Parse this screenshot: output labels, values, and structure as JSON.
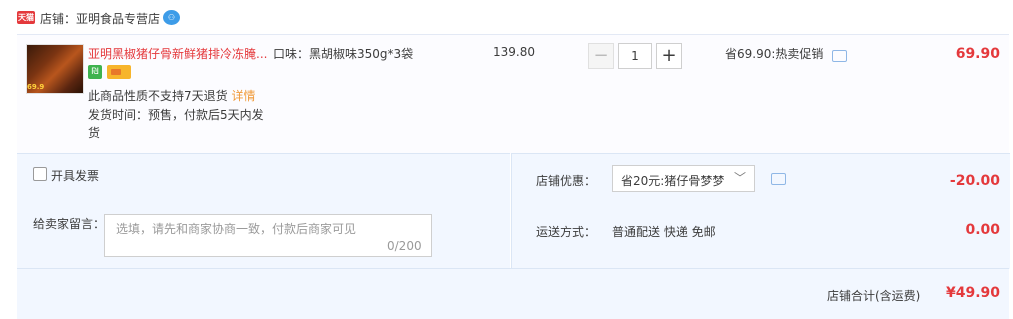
{
  "shop": {
    "badge": "天猫",
    "label": "店铺：亚明食品专营店",
    "chat_icon": "chat-icon"
  },
  "item": {
    "thumb_price": "69.9",
    "title": "亚明黑椒猪仔骨新鲜猪排冷冻腌...",
    "flavor": "口味：黑胡椒味350g*3袋",
    "unit_price": "139.80",
    "quantity": "1",
    "minus": "−",
    "plus": "+",
    "notice_return": "此商品性质不支持7天退货",
    "notice_link": "详情",
    "notice_ship": "发货时间：预售，付款后5天内发货",
    "promo": "省69.90:热卖促销",
    "total": "69.90"
  },
  "invoice": {
    "label": "开具发票"
  },
  "message": {
    "label": "给卖家留言：",
    "placeholder": "选填，请先和商家协商一致，付款后商家可见",
    "count": "0/200"
  },
  "discount": {
    "label": "店铺优惠：",
    "value": "省20元:猪仔骨梦梦",
    "amount": "-20.00"
  },
  "shipping": {
    "label": "运送方式：",
    "value": "普通配送 快递 免邮",
    "amount": "0.00"
  },
  "footer": {
    "label": "店铺合计(含运费)",
    "amount": "¥49.90"
  },
  "colors": {
    "price_red": "#e4393c",
    "panel_bg": "#f2f7ff",
    "link_orange": "#f09a39"
  }
}
